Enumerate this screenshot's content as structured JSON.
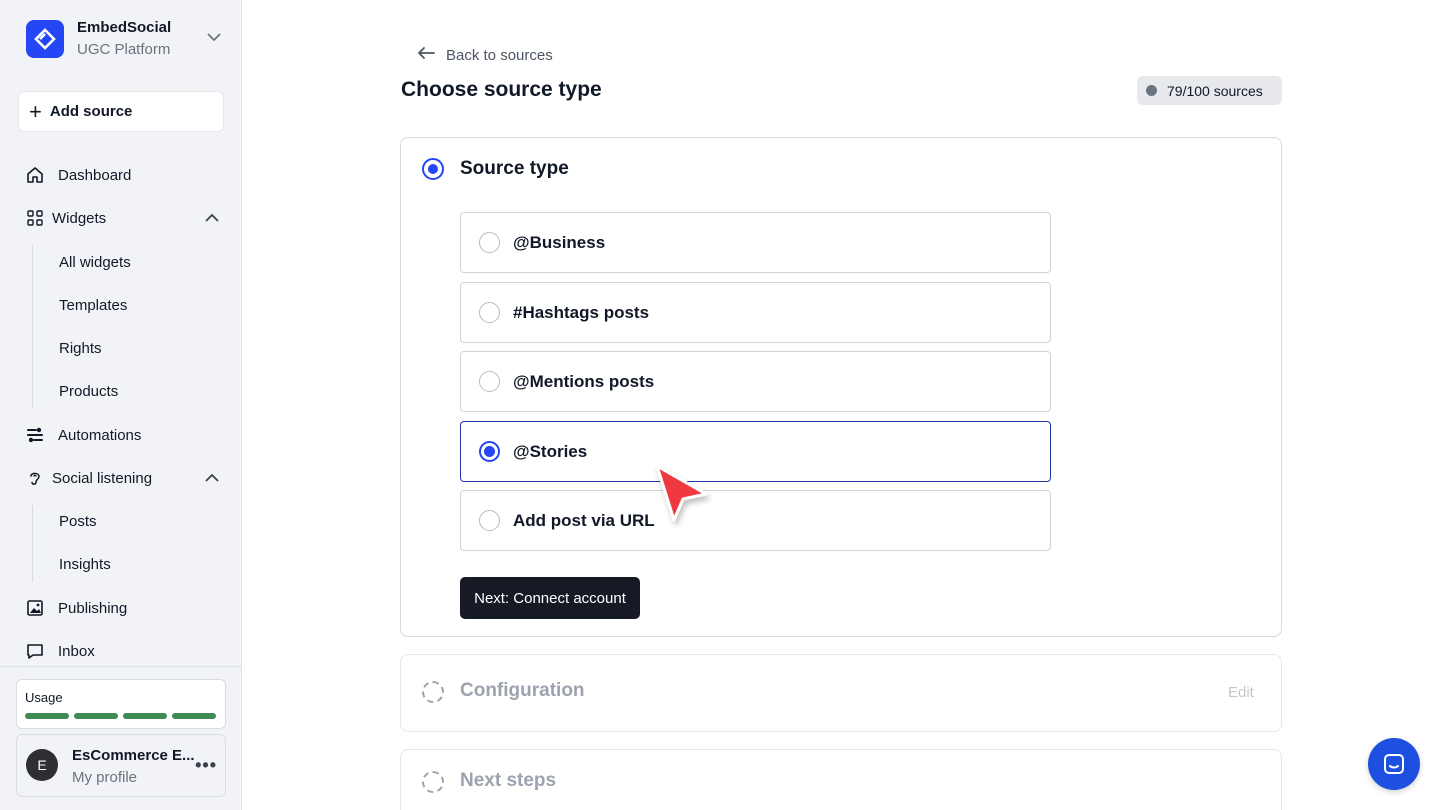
{
  "brand": {
    "name": "EmbedSocial",
    "subtitle": "UGC Platform"
  },
  "sidebar": {
    "add_source": "Add source",
    "dashboard": "Dashboard",
    "widgets": "Widgets",
    "widgets_sub": [
      "All widgets",
      "Templates",
      "Rights",
      "Products"
    ],
    "automations": "Automations",
    "social_listening": "Social listening",
    "social_sub": [
      "Posts",
      "Insights"
    ],
    "publishing": "Publishing",
    "inbox": "Inbox",
    "usage_label": "Usage",
    "profile": {
      "initial": "E",
      "name": "EsCommerce E...",
      "subtitle": "My profile"
    }
  },
  "main": {
    "back_label": "Back to sources",
    "title": "Choose source type",
    "sources_badge": "79/100 sources",
    "step1_title": "Source type",
    "options": [
      "@Business",
      "#Hashtags posts",
      "@Mentions posts",
      "@Stories",
      "Add post via URL"
    ],
    "selected_option": "@Stories",
    "next_button": "Next: Connect account",
    "step2_title": "Configuration",
    "step2_edit": "Edit",
    "step3_title": "Next steps"
  },
  "colors": {
    "accent": "#2446f4",
    "usage_bar": "#3d8b52",
    "cursor": "#f0383f"
  }
}
